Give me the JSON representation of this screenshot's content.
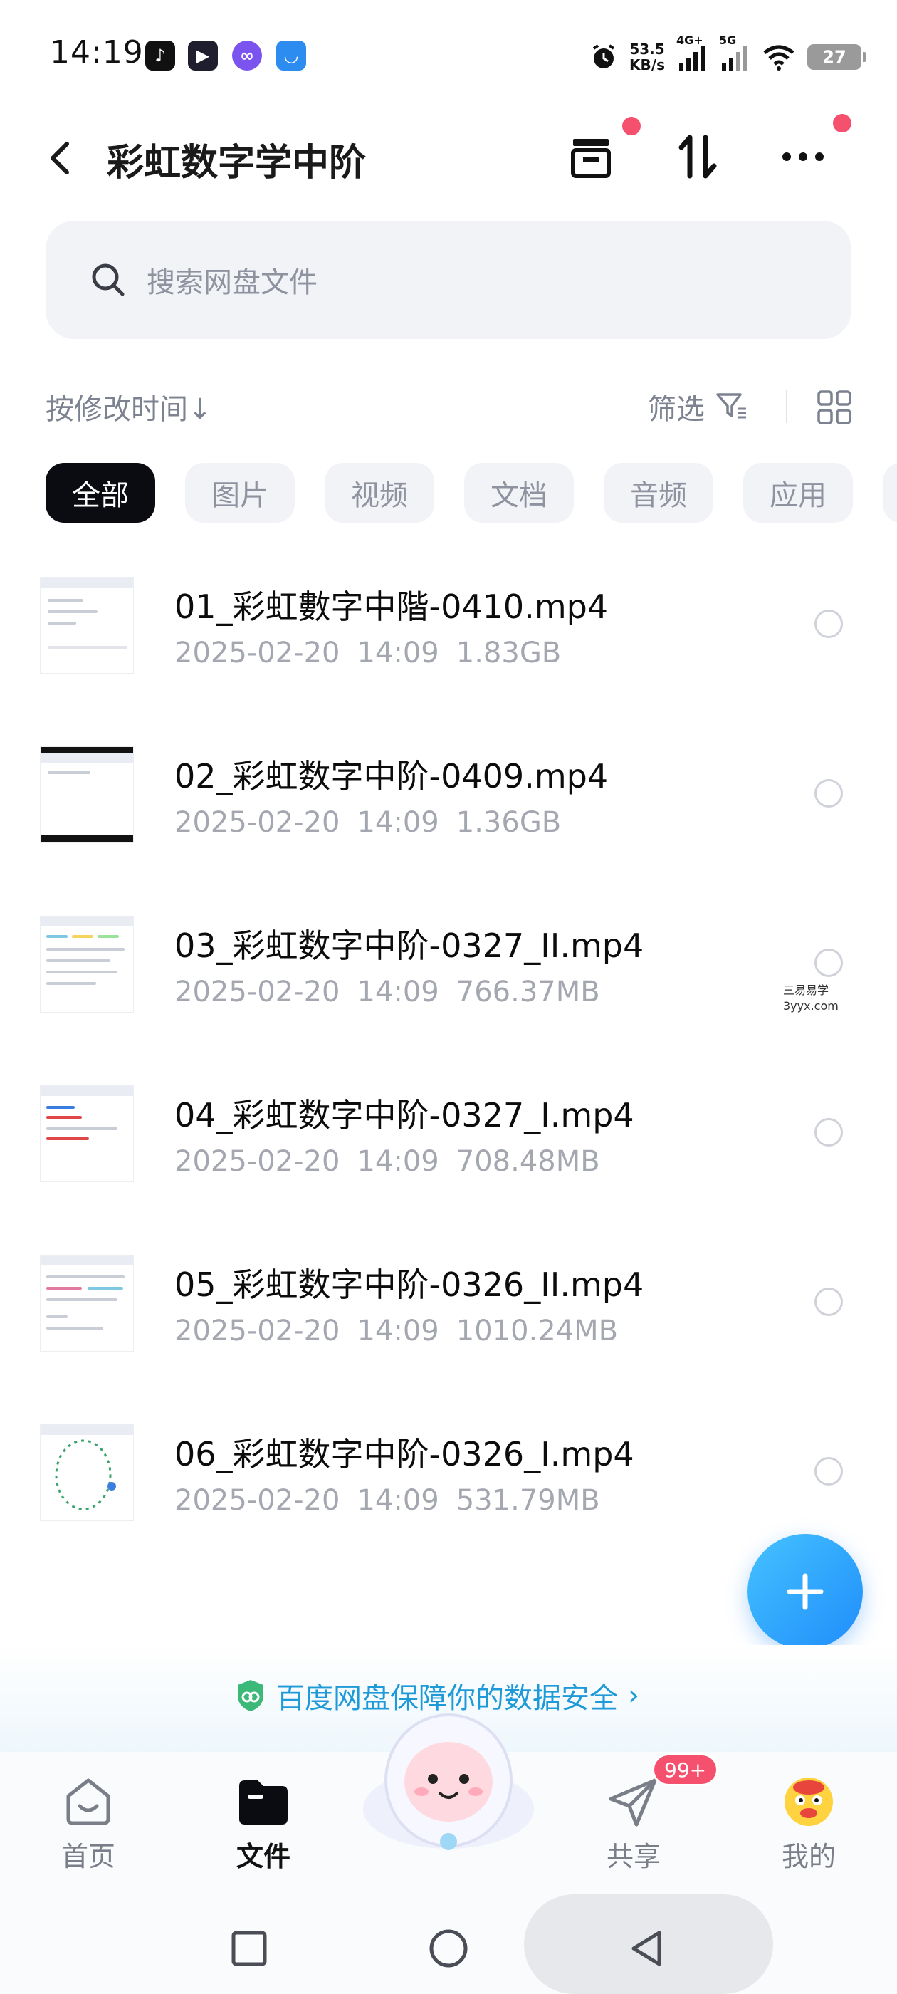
{
  "status_bar": {
    "time": "14:19",
    "net_speed_value": "53.5",
    "net_speed_unit": "KB/s",
    "net_4g": "4G+",
    "net_5g": "5G",
    "battery": "27",
    "app_icons": [
      "tiktok-icon",
      "video-player-icon",
      "infinity-app-icon",
      "clip-app-icon"
    ]
  },
  "header": {
    "title": "彩虹数字学中阶",
    "back_icon": "back-chevron-icon",
    "actions": [
      "archive-box-icon",
      "sort-transfer-icon",
      "more-dots-icon"
    ]
  },
  "search": {
    "placeholder": "搜索网盘文件"
  },
  "sort_bar": {
    "sort_label": "按修改时间",
    "sort_arrow": "↓",
    "filter_label": "筛选"
  },
  "chips": [
    "全部",
    "图片",
    "视频",
    "文档",
    "音频",
    "应用"
  ],
  "active_chip": "全部",
  "files": [
    {
      "name": "01_彩虹數字中階-0410.mp4",
      "date": "2025-02-20",
      "time": "14:09",
      "size": "1.83GB"
    },
    {
      "name": "02_彩虹数字中阶-0409.mp4",
      "date": "2025-02-20",
      "time": "14:09",
      "size": "1.36GB"
    },
    {
      "name": "03_彩虹数字中阶-0327_II.mp4",
      "date": "2025-02-20",
      "time": "14:09",
      "size": "766.37MB"
    },
    {
      "name": "04_彩虹数字中阶-0327_I.mp4",
      "date": "2025-02-20",
      "time": "14:09",
      "size": "708.48MB"
    },
    {
      "name": "05_彩虹数字中阶-0326_II.mp4",
      "date": "2025-02-20",
      "time": "14:09",
      "size": "1010.24MB"
    },
    {
      "name": "06_彩虹数字中阶-0326_I.mp4",
      "date": "2025-02-20",
      "time": "14:09",
      "size": "531.79MB"
    }
  ],
  "watermark": {
    "line1": "三易易学",
    "line2": "3yyx.com"
  },
  "security_banner": {
    "text": "百度网盘保障你的数据安全",
    "chevron": "›"
  },
  "bottom_nav": {
    "items": [
      {
        "label": "首页",
        "icon": "home-icon"
      },
      {
        "label": "文件",
        "icon": "folder-icon"
      },
      {
        "label": "共享",
        "icon": "paper-plane-icon"
      },
      {
        "label": "我的",
        "icon": "avatar-icon"
      }
    ],
    "active": "文件",
    "share_badge": "99+"
  },
  "colors": {
    "accent": "#1f9ad8",
    "active_chip_bg": "#0b0b12",
    "red_dot": "#f5506e",
    "fab": "#2a9bff"
  }
}
